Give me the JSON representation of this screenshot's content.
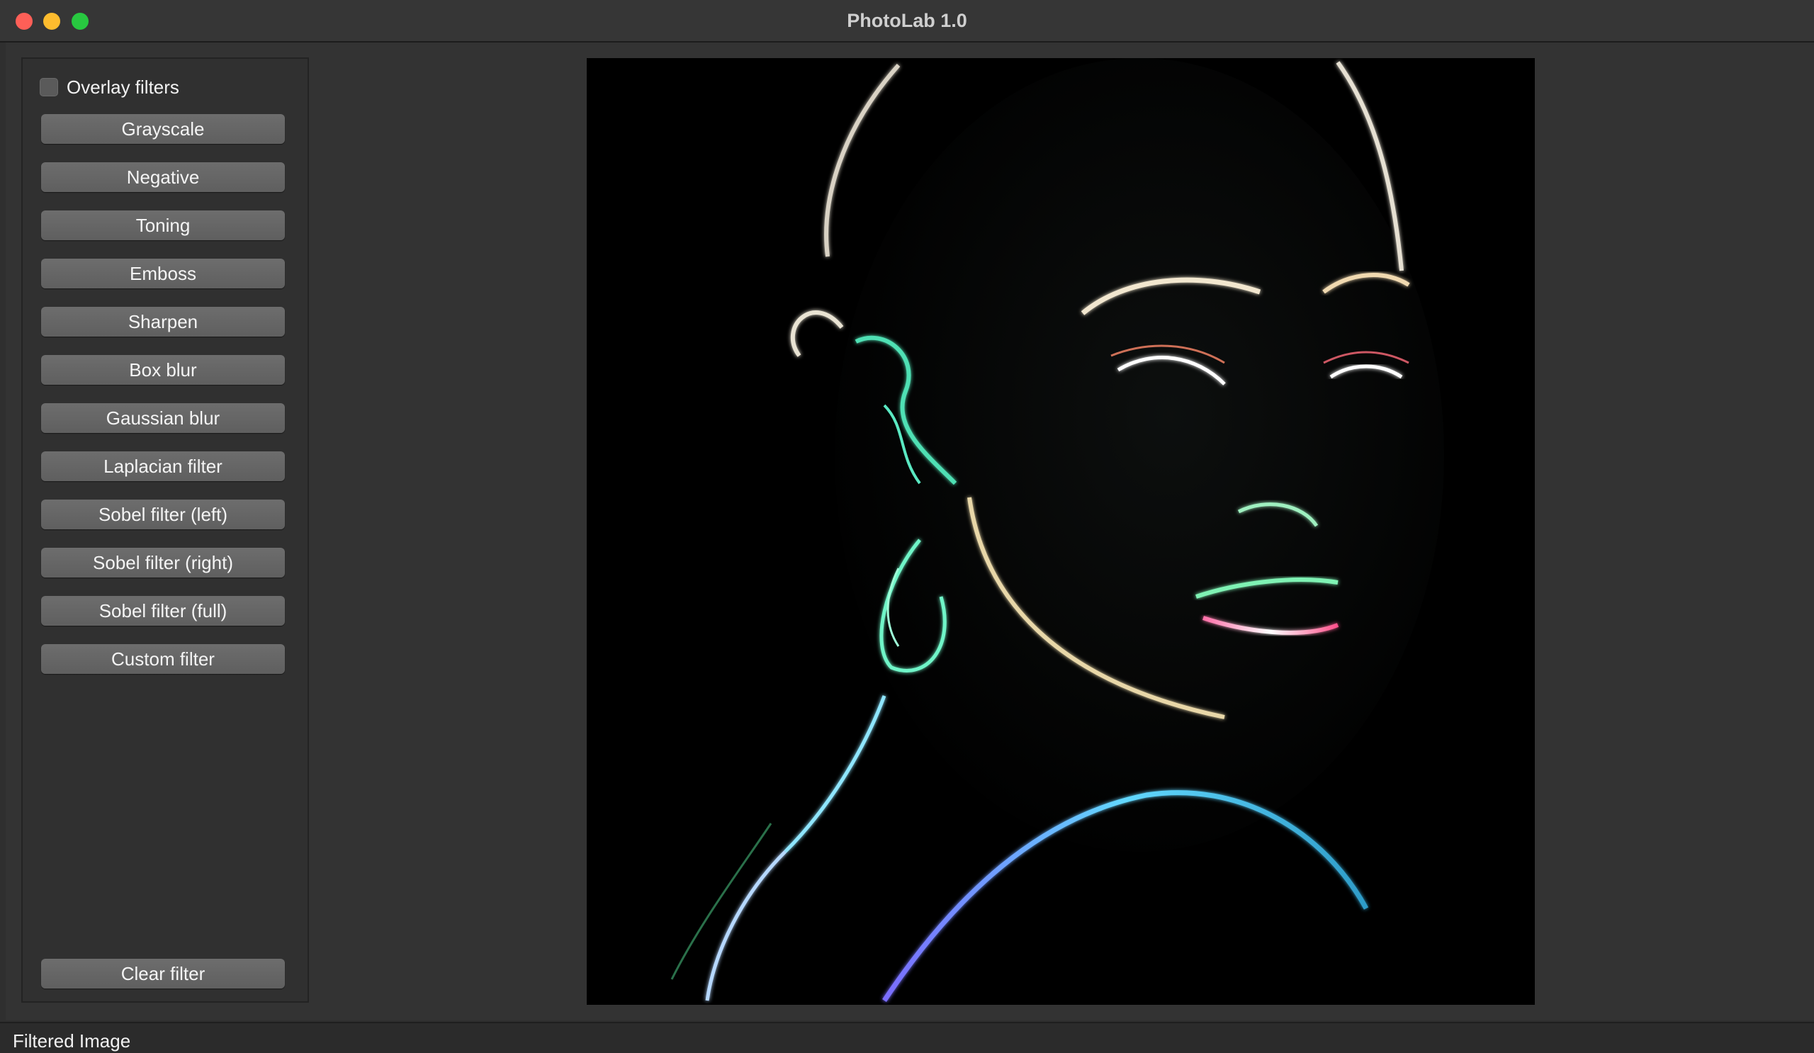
{
  "window": {
    "title": "PhotoLab 1.0"
  },
  "sidebar": {
    "overlay_checkbox": {
      "label": "Overlay filters",
      "checked": false
    },
    "filters": [
      {
        "label": "Grayscale"
      },
      {
        "label": "Negative"
      },
      {
        "label": "Toning"
      },
      {
        "label": "Emboss"
      },
      {
        "label": "Sharpen"
      },
      {
        "label": "Box blur"
      },
      {
        "label": "Gaussian blur"
      },
      {
        "label": "Laplacian filter"
      },
      {
        "label": "Sobel filter (left)"
      },
      {
        "label": "Sobel filter (right)"
      },
      {
        "label": "Sobel filter (full)"
      },
      {
        "label": "Custom filter"
      }
    ],
    "clear_label": "Clear filter"
  },
  "status": {
    "text": "Filtered Image"
  },
  "colors": {
    "background": "#333333",
    "button": "#666666",
    "close": "#fe5f57",
    "minimize": "#febc2e",
    "zoom": "#28c840"
  }
}
